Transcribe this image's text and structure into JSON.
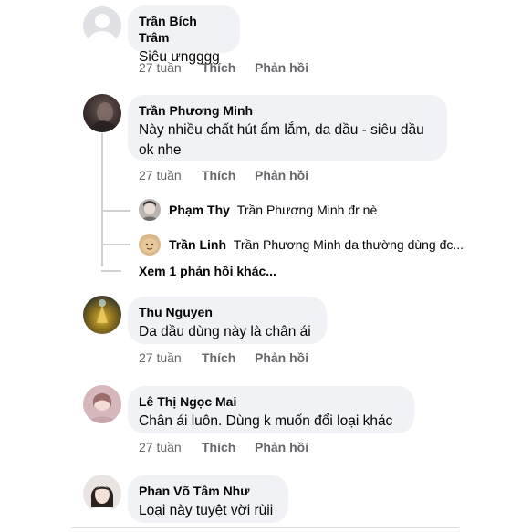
{
  "comments": [
    {
      "author": "Trần Bích Trâm",
      "text": "Siêu ưngggg",
      "time": "27 tuần",
      "like": "Thích",
      "reply": "Phản hồi",
      "avatar": "default-avatar"
    },
    {
      "author": "Trần Phương Minh",
      "text_lines": [
        "Này nhiều chất hút ẩm lắm, da dầu - siêu dầu",
        "ok nhe"
      ],
      "time": "27 tuần",
      "like": "Thích",
      "reply": "Phản hồi",
      "avatar": "user-photo-avatar"
    },
    {
      "author": "Thu Nguyen",
      "text": "Da dầu dùng này là chân ái",
      "time": "27 tuần",
      "like": "Thích",
      "reply": "Phản hồi",
      "avatar": "user-photo-avatar"
    },
    {
      "author": "Lê Thị Ngọc Mai",
      "text": "Chân ái luôn. Dùng k muốn đổi loại khác",
      "time": "27 tuần",
      "like": "Thích",
      "reply": "Phản hồi",
      "avatar": "user-photo-avatar"
    },
    {
      "author": "Phan Võ Tâm Như",
      "text": "Loại này tuyệt vời rùii",
      "avatar": "user-photo-avatar"
    }
  ],
  "replies": [
    {
      "author": "Phạm Thy",
      "text": "Trần Phương Minh đr nè"
    },
    {
      "author": "Trần Linh",
      "text": "Trần Phương Minh da thường dùng đc..."
    }
  ],
  "view_more": "Xem 1 phản hồi khác...",
  "colors": {
    "bubble": "#f0f2f5",
    "meta": "#65676b",
    "thread_line": "#ced0d4"
  }
}
